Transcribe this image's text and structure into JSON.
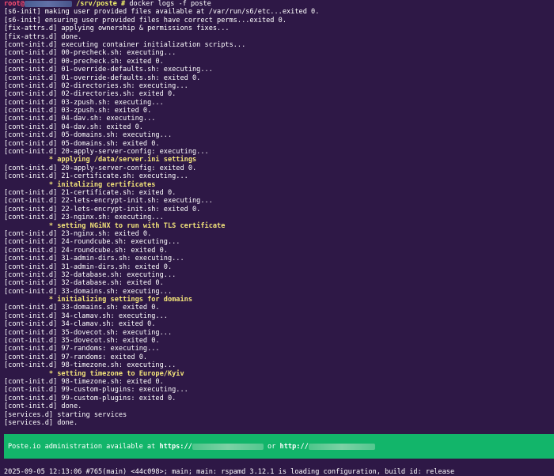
{
  "prompt": {
    "user": "root@",
    "path": "/srv/poste",
    "hash": "#",
    "command": "docker logs -f poste"
  },
  "log_lines": [
    {
      "text": "[s6-init] making user provided files available at /var/run/s6/etc...exited 0.",
      "style": "normal"
    },
    {
      "text": "[s6-init] ensuring user provided files have correct perms...exited 0.",
      "style": "normal"
    },
    {
      "text": "[fix-attrs.d] applying ownership & permissions fixes...",
      "style": "normal"
    },
    {
      "text": "[fix-attrs.d] done.",
      "style": "normal"
    },
    {
      "text": "[cont-init.d] executing container initialization scripts...",
      "style": "normal"
    },
    {
      "text": "[cont-init.d] 00-precheck.sh: executing...",
      "style": "normal"
    },
    {
      "text": "[cont-init.d] 00-precheck.sh: exited 0.",
      "style": "normal"
    },
    {
      "text": "[cont-init.d] 01-override-defaults.sh: executing...",
      "style": "normal"
    },
    {
      "text": "[cont-init.d] 01-override-defaults.sh: exited 0.",
      "style": "normal"
    },
    {
      "text": "[cont-init.d] 02-directories.sh: executing...",
      "style": "normal"
    },
    {
      "text": "[cont-init.d] 02-directories.sh: exited 0.",
      "style": "normal"
    },
    {
      "text": "[cont-init.d] 03-zpush.sh: executing...",
      "style": "normal"
    },
    {
      "text": "[cont-init.d] 03-zpush.sh: exited 0.",
      "style": "normal"
    },
    {
      "text": "[cont-init.d] 04-dav.sh: executing...",
      "style": "normal"
    },
    {
      "text": "[cont-init.d] 04-dav.sh: exited 0.",
      "style": "normal"
    },
    {
      "text": "[cont-init.d] 05-domains.sh: executing...",
      "style": "normal"
    },
    {
      "text": "[cont-init.d] 05-domains.sh: exited 0.",
      "style": "normal"
    },
    {
      "text": "[cont-init.d] 20-apply-server-config: executing...",
      "style": "normal"
    },
    {
      "text": "           * applying /data/server.ini settings",
      "style": "yellow"
    },
    {
      "text": "[cont-init.d] 20-apply-server-config: exited 0.",
      "style": "normal"
    },
    {
      "text": "[cont-init.d] 21-certificate.sh: executing...",
      "style": "normal"
    },
    {
      "text": "           * initalizing certificates",
      "style": "yellow"
    },
    {
      "text": "[cont-init.d] 21-certificate.sh: exited 0.",
      "style": "normal"
    },
    {
      "text": "[cont-init.d] 22-lets-encrypt-init.sh: executing...",
      "style": "normal"
    },
    {
      "text": "[cont-init.d] 22-lets-encrypt-init.sh: exited 0.",
      "style": "normal"
    },
    {
      "text": "[cont-init.d] 23-nginx.sh: executing...",
      "style": "normal"
    },
    {
      "text": "           * setting NGiNX to run with TLS certificate",
      "style": "yellow"
    },
    {
      "text": "[cont-init.d] 23-nginx.sh: exited 0.",
      "style": "normal"
    },
    {
      "text": "[cont-init.d] 24-roundcube.sh: executing...",
      "style": "normal"
    },
    {
      "text": "[cont-init.d] 24-roundcube.sh: exited 0.",
      "style": "normal"
    },
    {
      "text": "[cont-init.d] 31-admin-dirs.sh: executing...",
      "style": "normal"
    },
    {
      "text": "[cont-init.d] 31-admin-dirs.sh: exited 0.",
      "style": "normal"
    },
    {
      "text": "[cont-init.d] 32-database.sh: executing...",
      "style": "normal"
    },
    {
      "text": "[cont-init.d] 32-database.sh: exited 0.",
      "style": "normal"
    },
    {
      "text": "[cont-init.d] 33-domains.sh: executing...",
      "style": "normal"
    },
    {
      "text": "           * initializing settings for domains",
      "style": "yellow"
    },
    {
      "text": "[cont-init.d] 33-domains.sh: exited 0.",
      "style": "normal"
    },
    {
      "text": "[cont-init.d] 34-clamav.sh: executing...",
      "style": "normal"
    },
    {
      "text": "[cont-init.d] 34-clamav.sh: exited 0.",
      "style": "normal"
    },
    {
      "text": "[cont-init.d] 35-dovecot.sh: executing...",
      "style": "normal"
    },
    {
      "text": "[cont-init.d] 35-dovecot.sh: exited 0.",
      "style": "normal"
    },
    {
      "text": "[cont-init.d] 97-randoms: executing...",
      "style": "normal"
    },
    {
      "text": "[cont-init.d] 97-randoms: exited 0.",
      "style": "normal"
    },
    {
      "text": "[cont-init.d] 98-timezone.sh: executing...",
      "style": "normal"
    },
    {
      "text": "           * setting timezone to Europe/Kyiv",
      "style": "yellow"
    },
    {
      "text": "[cont-init.d] 98-timezone.sh: exited 0.",
      "style": "normal"
    },
    {
      "text": "[cont-init.d] 99-custom-plugins: executing...",
      "style": "normal"
    },
    {
      "text": "[cont-init.d] 99-custom-plugins: exited 0.",
      "style": "normal"
    },
    {
      "text": "[cont-init.d] done.",
      "style": "normal"
    },
    {
      "text": "[services.d] starting services",
      "style": "normal"
    },
    {
      "text": "[services.d] done.",
      "style": "normal"
    }
  ],
  "banner": {
    "prefix": "Poste.io administration available at ",
    "https": "https://",
    "or": " or ",
    "http": "http://"
  },
  "status_line": "2025-09-05 12:13:06 #765(main) <44c098>; main; main: rspamd 3.12.1 is loading configuration, build id: release",
  "colors": {
    "background": "#2e1846",
    "prompt_user": "#ff4f72",
    "prompt_path": "#f2f26a",
    "highlight": "#f3e47a",
    "banner_bg": "#12b56a"
  }
}
